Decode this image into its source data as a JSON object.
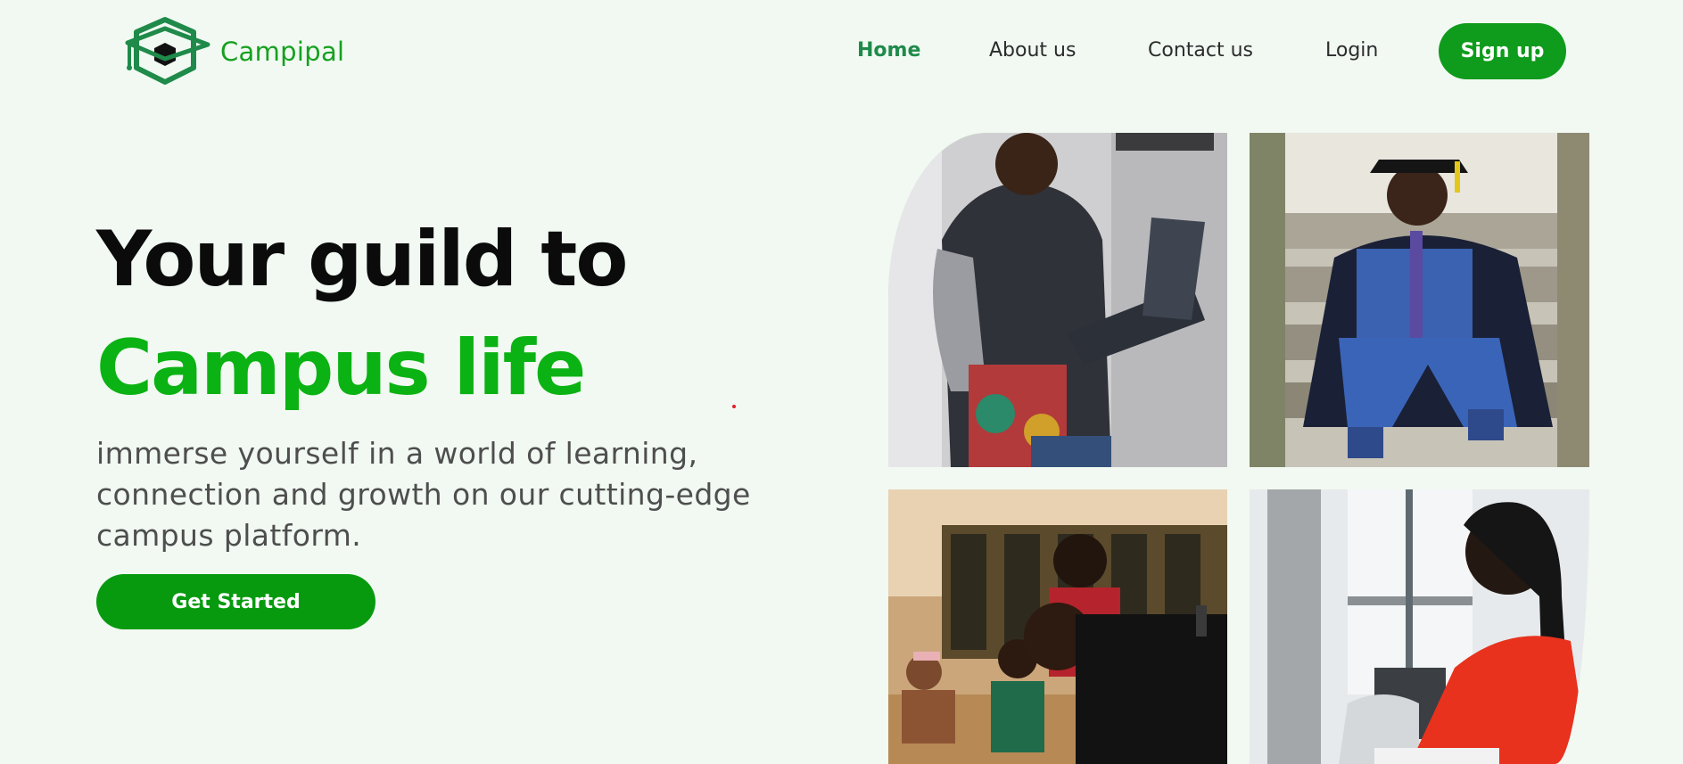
{
  "brand": {
    "name": "Campipal",
    "color": "#16a01f"
  },
  "nav": {
    "items": [
      {
        "label": "Home",
        "active": true
      },
      {
        "label": "About us",
        "active": false
      },
      {
        "label": "Contact us",
        "active": false
      },
      {
        "label": "Login",
        "active": false
      }
    ],
    "signup_label": "Sign up"
  },
  "hero": {
    "title_line1": "Your guild to",
    "title_line2": "Campus life",
    "description": "immerse yourself in a world of learning, connection and growth on our cutting-edge campus platform.",
    "cta_label": "Get Started"
  },
  "gallery": {
    "photos": [
      {
        "name": "student-with-laptop-photo"
      },
      {
        "name": "graduate-on-stairs-photo"
      },
      {
        "name": "students-studying-photo"
      },
      {
        "name": "student-reading-photo"
      }
    ]
  },
  "colors": {
    "background": "#f1f9f2",
    "accent": "#0f9b1c",
    "title_green": "#0bb213",
    "nav_active": "#1f8a4a"
  }
}
